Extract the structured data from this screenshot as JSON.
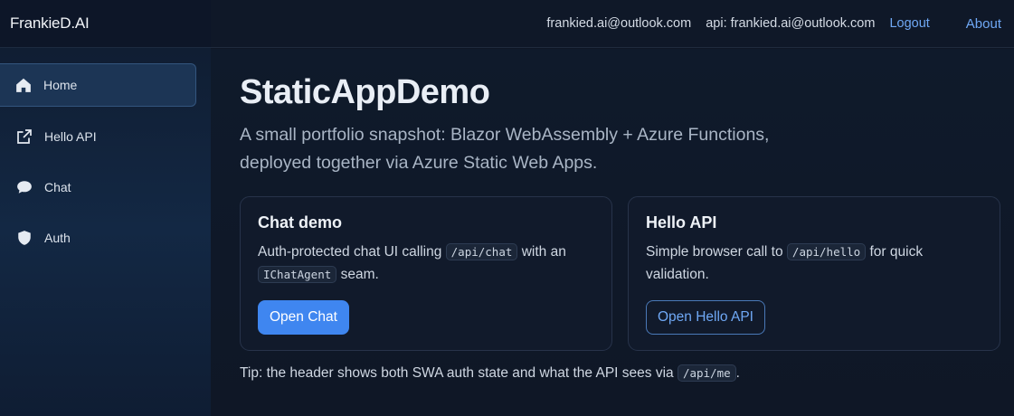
{
  "brand": "FrankieD.AI",
  "header": {
    "user_email": "frankied.ai@outlook.com",
    "api_label": "api: frankied.ai@outlook.com",
    "logout": "Logout",
    "about": "About"
  },
  "sidebar": {
    "items": [
      {
        "label": "Home",
        "icon": "home-icon",
        "active": true
      },
      {
        "label": "Hello API",
        "icon": "external-link-icon",
        "active": false
      },
      {
        "label": "Chat",
        "icon": "chat-bubble-icon",
        "active": false
      },
      {
        "label": "Auth",
        "icon": "shield-icon",
        "active": false
      }
    ]
  },
  "main": {
    "title": "StaticAppDemo",
    "lead": "A small portfolio snapshot: Blazor WebAssembly + Azure Functions, deployed together via Azure Static Web Apps.",
    "cards": [
      {
        "title": "Chat demo",
        "text_before": "Auth-protected chat UI calling",
        "code_1": "/api/chat",
        "text_middle": "with an",
        "code_2": "IChatAgent",
        "text_after": "seam.",
        "button": "Open Chat"
      },
      {
        "title": "Hello API",
        "text_before": "Simple browser call to",
        "code_1": "/api/hello",
        "text_after": "for quick validation.",
        "button": "Open Hello API"
      }
    ],
    "tip_before": "Tip: the header shows both SWA auth state and what the API sees via",
    "tip_code": "/api/me",
    "tip_after": "."
  },
  "colors": {
    "accent": "#3f86f0",
    "link": "#6fa8f5",
    "background": "#0f1726"
  }
}
